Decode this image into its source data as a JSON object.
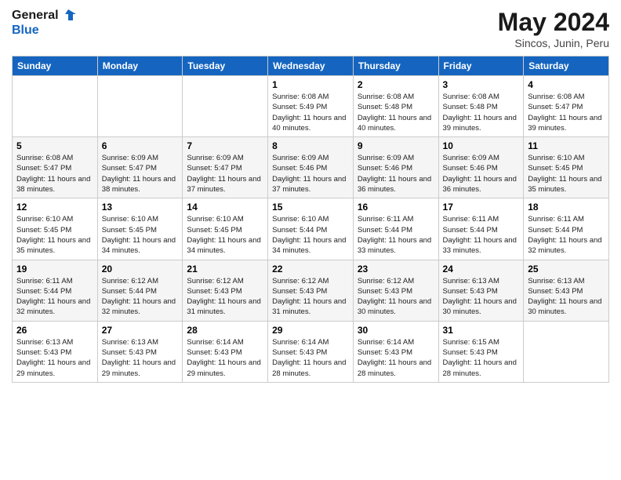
{
  "header": {
    "logo_line1": "General",
    "logo_line2": "Blue",
    "month": "May 2024",
    "location": "Sincos, Junin, Peru"
  },
  "weekdays": [
    "Sunday",
    "Monday",
    "Tuesday",
    "Wednesday",
    "Thursday",
    "Friday",
    "Saturday"
  ],
  "weeks": [
    [
      {
        "day": "",
        "info": ""
      },
      {
        "day": "",
        "info": ""
      },
      {
        "day": "",
        "info": ""
      },
      {
        "day": "1",
        "info": "Sunrise: 6:08 AM\nSunset: 5:49 PM\nDaylight: 11 hours and 40 minutes."
      },
      {
        "day": "2",
        "info": "Sunrise: 6:08 AM\nSunset: 5:48 PM\nDaylight: 11 hours and 40 minutes."
      },
      {
        "day": "3",
        "info": "Sunrise: 6:08 AM\nSunset: 5:48 PM\nDaylight: 11 hours and 39 minutes."
      },
      {
        "day": "4",
        "info": "Sunrise: 6:08 AM\nSunset: 5:47 PM\nDaylight: 11 hours and 39 minutes."
      }
    ],
    [
      {
        "day": "5",
        "info": "Sunrise: 6:08 AM\nSunset: 5:47 PM\nDaylight: 11 hours and 38 minutes."
      },
      {
        "day": "6",
        "info": "Sunrise: 6:09 AM\nSunset: 5:47 PM\nDaylight: 11 hours and 38 minutes."
      },
      {
        "day": "7",
        "info": "Sunrise: 6:09 AM\nSunset: 5:47 PM\nDaylight: 11 hours and 37 minutes."
      },
      {
        "day": "8",
        "info": "Sunrise: 6:09 AM\nSunset: 5:46 PM\nDaylight: 11 hours and 37 minutes."
      },
      {
        "day": "9",
        "info": "Sunrise: 6:09 AM\nSunset: 5:46 PM\nDaylight: 11 hours and 36 minutes."
      },
      {
        "day": "10",
        "info": "Sunrise: 6:09 AM\nSunset: 5:46 PM\nDaylight: 11 hours and 36 minutes."
      },
      {
        "day": "11",
        "info": "Sunrise: 6:10 AM\nSunset: 5:45 PM\nDaylight: 11 hours and 35 minutes."
      }
    ],
    [
      {
        "day": "12",
        "info": "Sunrise: 6:10 AM\nSunset: 5:45 PM\nDaylight: 11 hours and 35 minutes."
      },
      {
        "day": "13",
        "info": "Sunrise: 6:10 AM\nSunset: 5:45 PM\nDaylight: 11 hours and 34 minutes."
      },
      {
        "day": "14",
        "info": "Sunrise: 6:10 AM\nSunset: 5:45 PM\nDaylight: 11 hours and 34 minutes."
      },
      {
        "day": "15",
        "info": "Sunrise: 6:10 AM\nSunset: 5:44 PM\nDaylight: 11 hours and 34 minutes."
      },
      {
        "day": "16",
        "info": "Sunrise: 6:11 AM\nSunset: 5:44 PM\nDaylight: 11 hours and 33 minutes."
      },
      {
        "day": "17",
        "info": "Sunrise: 6:11 AM\nSunset: 5:44 PM\nDaylight: 11 hours and 33 minutes."
      },
      {
        "day": "18",
        "info": "Sunrise: 6:11 AM\nSunset: 5:44 PM\nDaylight: 11 hours and 32 minutes."
      }
    ],
    [
      {
        "day": "19",
        "info": "Sunrise: 6:11 AM\nSunset: 5:44 PM\nDaylight: 11 hours and 32 minutes."
      },
      {
        "day": "20",
        "info": "Sunrise: 6:12 AM\nSunset: 5:44 PM\nDaylight: 11 hours and 32 minutes."
      },
      {
        "day": "21",
        "info": "Sunrise: 6:12 AM\nSunset: 5:43 PM\nDaylight: 11 hours and 31 minutes."
      },
      {
        "day": "22",
        "info": "Sunrise: 6:12 AM\nSunset: 5:43 PM\nDaylight: 11 hours and 31 minutes."
      },
      {
        "day": "23",
        "info": "Sunrise: 6:12 AM\nSunset: 5:43 PM\nDaylight: 11 hours and 30 minutes."
      },
      {
        "day": "24",
        "info": "Sunrise: 6:13 AM\nSunset: 5:43 PM\nDaylight: 11 hours and 30 minutes."
      },
      {
        "day": "25",
        "info": "Sunrise: 6:13 AM\nSunset: 5:43 PM\nDaylight: 11 hours and 30 minutes."
      }
    ],
    [
      {
        "day": "26",
        "info": "Sunrise: 6:13 AM\nSunset: 5:43 PM\nDaylight: 11 hours and 29 minutes."
      },
      {
        "day": "27",
        "info": "Sunrise: 6:13 AM\nSunset: 5:43 PM\nDaylight: 11 hours and 29 minutes."
      },
      {
        "day": "28",
        "info": "Sunrise: 6:14 AM\nSunset: 5:43 PM\nDaylight: 11 hours and 29 minutes."
      },
      {
        "day": "29",
        "info": "Sunrise: 6:14 AM\nSunset: 5:43 PM\nDaylight: 11 hours and 28 minutes."
      },
      {
        "day": "30",
        "info": "Sunrise: 6:14 AM\nSunset: 5:43 PM\nDaylight: 11 hours and 28 minutes."
      },
      {
        "day": "31",
        "info": "Sunrise: 6:15 AM\nSunset: 5:43 PM\nDaylight: 11 hours and 28 minutes."
      },
      {
        "day": "",
        "info": ""
      }
    ]
  ]
}
